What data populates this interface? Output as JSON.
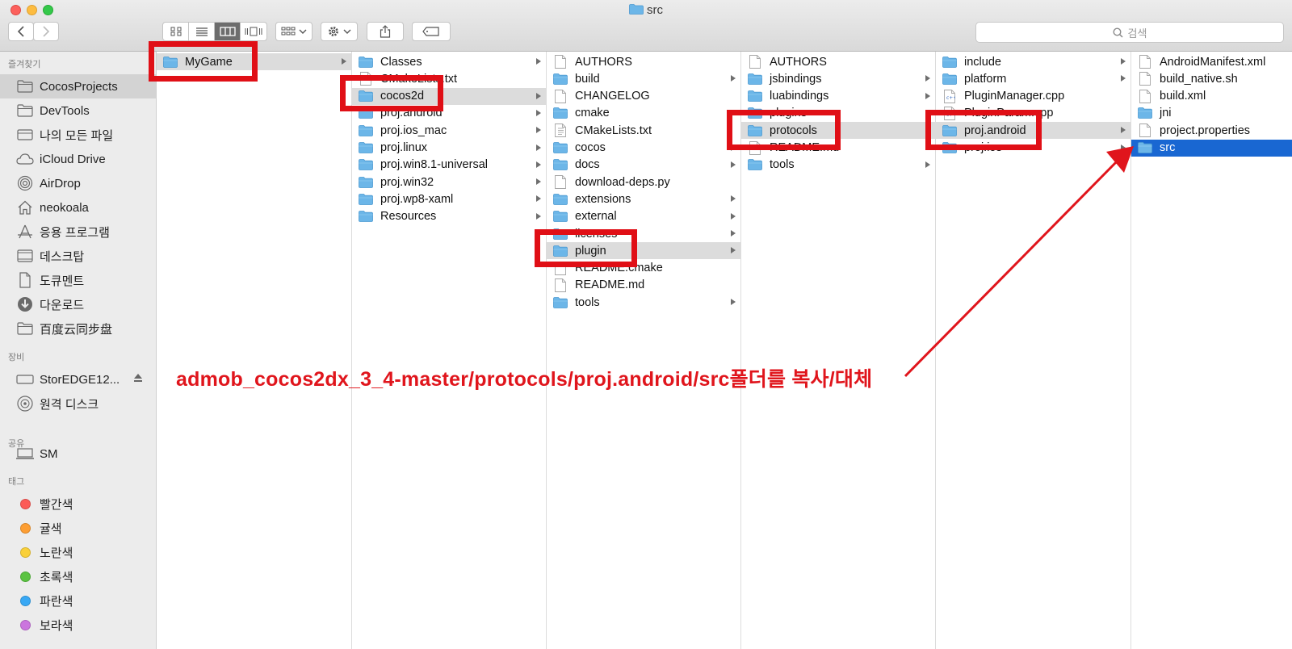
{
  "window": {
    "title": "src"
  },
  "toolbar": {
    "search_placeholder": "검색"
  },
  "sidebar": {
    "sections": [
      {
        "header": "즐겨찾기",
        "items": [
          {
            "label": "CocosProjects",
            "icon": "folder-icon",
            "selected": true
          },
          {
            "label": "DevTools",
            "icon": "folder-icon"
          },
          {
            "label": "나의 모든 파일",
            "icon": "all-files-icon"
          },
          {
            "label": "iCloud Drive",
            "icon": "cloud-icon"
          },
          {
            "label": "AirDrop",
            "icon": "airdrop-icon"
          },
          {
            "label": "neokoala",
            "icon": "home-icon"
          },
          {
            "label": "응용 프로그램",
            "icon": "applications-icon"
          },
          {
            "label": "데스크탑",
            "icon": "desktop-icon"
          },
          {
            "label": "도큐멘트",
            "icon": "documents-icon"
          },
          {
            "label": "다운로드",
            "icon": "downloads-icon"
          },
          {
            "label": "百度云同步盘",
            "icon": "folder-icon"
          }
        ]
      },
      {
        "header": "장비",
        "items": [
          {
            "label": "StorEDGE12...",
            "icon": "drive-icon",
            "eject": true
          },
          {
            "label": "원격 디스크",
            "icon": "disc-icon"
          }
        ]
      },
      {
        "header": "공유",
        "items": [
          {
            "label": "SM",
            "icon": "computer-icon"
          }
        ]
      },
      {
        "header": "태그",
        "items": [
          {
            "label": "빨간색",
            "icon": "tag-icon",
            "color": "#fc5b57"
          },
          {
            "label": "귤색",
            "icon": "tag-icon",
            "color": "#fd9e33"
          },
          {
            "label": "노란색",
            "icon": "tag-icon",
            "color": "#f9d039"
          },
          {
            "label": "초록색",
            "icon": "tag-icon",
            "color": "#5ac341"
          },
          {
            "label": "파란색",
            "icon": "tag-icon",
            "color": "#38a8f4"
          },
          {
            "label": "보라색",
            "icon": "tag-icon",
            "color": "#cb75de"
          }
        ]
      }
    ]
  },
  "columns": [
    [
      {
        "name": "MyGame",
        "type": "folder",
        "arrow": true,
        "selected": true
      }
    ],
    [
      {
        "name": "Classes",
        "type": "folder",
        "arrow": true
      },
      {
        "name": "CMakeLists.txt",
        "type": "file"
      },
      {
        "name": "cocos2d",
        "type": "folder",
        "arrow": true,
        "selected": true
      },
      {
        "name": "proj.android",
        "type": "folder",
        "arrow": true
      },
      {
        "name": "proj.ios_mac",
        "type": "folder",
        "arrow": true
      },
      {
        "name": "proj.linux",
        "type": "folder",
        "arrow": true
      },
      {
        "name": "proj.win8.1-universal",
        "type": "folder",
        "arrow": true
      },
      {
        "name": "proj.win32",
        "type": "folder",
        "arrow": true
      },
      {
        "name": "proj.wp8-xaml",
        "type": "folder",
        "arrow": true
      },
      {
        "name": "Resources",
        "type": "folder",
        "arrow": true
      }
    ],
    [
      {
        "name": "AUTHORS",
        "type": "file"
      },
      {
        "name": "build",
        "type": "folder",
        "arrow": true
      },
      {
        "name": "CHANGELOG",
        "type": "file"
      },
      {
        "name": "cmake",
        "type": "folder",
        "arrow": true
      },
      {
        "name": "CMakeLists.txt",
        "type": "textfile"
      },
      {
        "name": "cocos",
        "type": "folder",
        "arrow": true
      },
      {
        "name": "docs",
        "type": "folder",
        "arrow": true
      },
      {
        "name": "download-deps.py",
        "type": "file"
      },
      {
        "name": "extensions",
        "type": "folder",
        "arrow": true
      },
      {
        "name": "external",
        "type": "folder",
        "arrow": true
      },
      {
        "name": "licenses",
        "type": "folder",
        "arrow": true
      },
      {
        "name": "plugin",
        "type": "folder",
        "arrow": true,
        "selected": true
      },
      {
        "name": "README.cmake",
        "type": "file"
      },
      {
        "name": "README.md",
        "type": "file"
      },
      {
        "name": "tools",
        "type": "folder",
        "arrow": true
      }
    ],
    [
      {
        "name": "AUTHORS",
        "type": "file"
      },
      {
        "name": "jsbindings",
        "type": "folder",
        "arrow": true
      },
      {
        "name": "luabindings",
        "type": "folder",
        "arrow": true
      },
      {
        "name": "plugins",
        "type": "folder",
        "arrow": true
      },
      {
        "name": "protocols",
        "type": "folder",
        "arrow": true,
        "selected": true
      },
      {
        "name": "README.md",
        "type": "file"
      },
      {
        "name": "tools",
        "type": "folder",
        "arrow": true
      }
    ],
    [
      {
        "name": "include",
        "type": "folder",
        "arrow": true
      },
      {
        "name": "platform",
        "type": "folder",
        "arrow": true
      },
      {
        "name": "PluginManager.cpp",
        "type": "cppfile"
      },
      {
        "name": "PluginParam.cpp",
        "type": "cppfile"
      },
      {
        "name": "proj.android",
        "type": "folder",
        "arrow": true,
        "selected": true
      },
      {
        "name": "proj.ios",
        "type": "folder",
        "arrow": true
      }
    ],
    [
      {
        "name": "AndroidManifest.xml",
        "type": "file"
      },
      {
        "name": "build_native.sh",
        "type": "file"
      },
      {
        "name": "build.xml",
        "type": "file"
      },
      {
        "name": "jni",
        "type": "folder"
      },
      {
        "name": "project.properties",
        "type": "file"
      },
      {
        "name": "src",
        "type": "folder",
        "active": true
      }
    ]
  ],
  "annotation": {
    "text": "admob_cocos2dx_3_4-master/protocols/proj.android/src폴더를 복사/대체",
    "color": "#e0151c"
  },
  "colors": {
    "folder": "#6cb6e8",
    "selection": "#1967d2",
    "highlight": "#e00f16"
  }
}
